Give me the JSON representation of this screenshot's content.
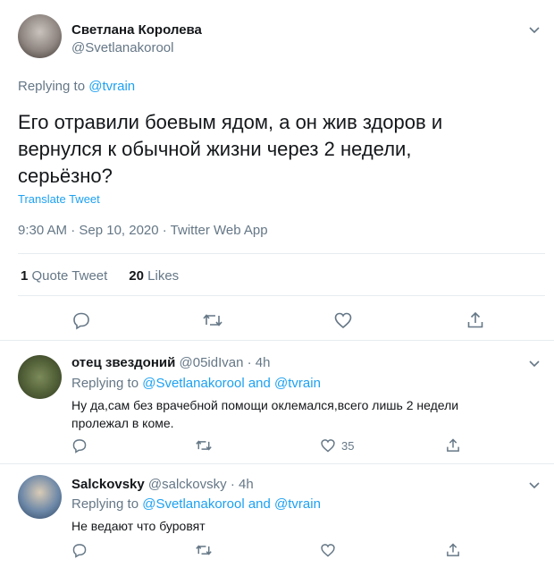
{
  "main_tweet": {
    "author_name": "Светлана Королева",
    "author_handle": "@Svetlanakorool",
    "replying_prefix": "Replying to",
    "replying_to": "@tvrain",
    "text_line1": "Его отравили боевым ядом, а он жив здоров и",
    "text_line2": "вернулся к обычной жизни через 2 недели,",
    "text_line3": "серьёзно?",
    "translate_label": "Translate Tweet",
    "meta": "9:30 AM · Sep 10, 2020 · Twitter Web App",
    "quote_count": "1",
    "quote_label": "Quote Tweet",
    "likes_count": "20",
    "likes_label": "Likes"
  },
  "replies": [
    {
      "author_name": "отец звездоний",
      "author_handle": "@05idIvan",
      "time": "· 4h",
      "replying_prefix": "Replying to",
      "replying_to": "@Svetlanakorool and @tvrain",
      "text_line1": "Ну да,сам без врачебной помощи оклемался,всего лишь 2 недели",
      "text_line2": "пролежал в коме.",
      "like_count": "35"
    },
    {
      "author_name": "Salckovsky",
      "author_handle": "@salckovsky",
      "time": "· 4h",
      "replying_prefix": "Replying to",
      "replying_to": "@Svetlanakorool and @tvrain",
      "text_line1": "Не ведают что буровят",
      "like_count": ""
    }
  ],
  "colors": {
    "accent": "#1da1f2",
    "muted": "#657786",
    "divider": "#e6ecf0"
  }
}
